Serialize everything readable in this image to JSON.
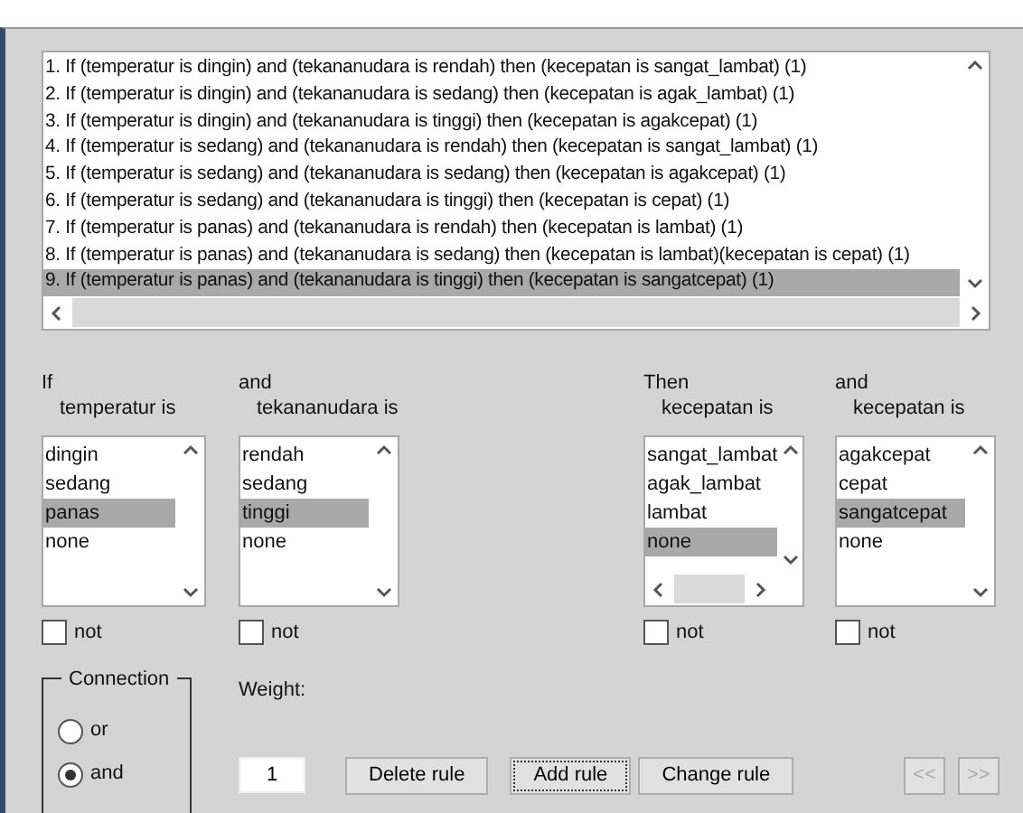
{
  "rules": [
    {
      "text": "1. If (temperatur is dingin) and (tekananudara is rendah) then (kecepatan is sangat_lambat) (1)",
      "selected": false
    },
    {
      "text": "2. If (temperatur is dingin) and (tekananudara is sedang) then (kecepatan is agak_lambat) (1)",
      "selected": false
    },
    {
      "text": "3. If (temperatur is dingin) and (tekananudara is tinggi) then (kecepatan is agakcepat) (1)",
      "selected": false
    },
    {
      "text": "4. If (temperatur is sedang) and (tekananudara is rendah) then (kecepatan is sangat_lambat) (1)",
      "selected": false
    },
    {
      "text": "5. If (temperatur is sedang) and (tekananudara is sedang) then (kecepatan is agakcepat) (1)",
      "selected": false
    },
    {
      "text": "6. If (temperatur is sedang) and (tekananudara is tinggi) then (kecepatan is cepat) (1)",
      "selected": false
    },
    {
      "text": "7. If (temperatur is panas) and (tekananudara is rendah) then (kecepatan is lambat) (1)",
      "selected": false
    },
    {
      "text": "8. If (temperatur is panas) and (tekananudara is sedang) then (kecepatan is lambat)(kecepatan is cepat) (1)",
      "selected": false
    },
    {
      "text": "9. If (temperatur is panas) and (tekananudara is tinggi) then (kecepatan is sangatcepat) (1)",
      "selected": true
    }
  ],
  "variables": [
    {
      "header": "If",
      "label": "temperatur is",
      "kind": "list",
      "items": [
        {
          "text": "dingin",
          "selected": false
        },
        {
          "text": "sedang",
          "selected": false
        },
        {
          "text": "panas",
          "selected": true
        },
        {
          "text": "none",
          "selected": false
        }
      ],
      "not_label": "not",
      "not_checked": false
    },
    {
      "header": "and",
      "label": "tekananudara is",
      "kind": "list",
      "items": [
        {
          "text": "rendah",
          "selected": false
        },
        {
          "text": "sedang",
          "selected": false
        },
        {
          "text": "tinggi",
          "selected": true
        },
        {
          "text": "none",
          "selected": false
        }
      ],
      "not_label": "not",
      "not_checked": false
    },
    {
      "header": "Then",
      "label": "kecepatan is",
      "kind": "list-hscroll",
      "items": [
        {
          "text": "sangat_lambat",
          "selected": false
        },
        {
          "text": "agak_lambat",
          "selected": false
        },
        {
          "text": "lambat",
          "selected": false
        },
        {
          "text": "none",
          "selected": true
        }
      ],
      "not_label": "not",
      "not_checked": false
    },
    {
      "header": "and",
      "label": "kecepatan is",
      "kind": "list",
      "items": [
        {
          "text": "agakcepat",
          "selected": false
        },
        {
          "text": "cepat",
          "selected": false
        },
        {
          "text": "sangatcepat",
          "selected": true
        },
        {
          "text": "none",
          "selected": false
        }
      ],
      "not_label": "not",
      "not_checked": false
    }
  ],
  "connection": {
    "title": "Connection",
    "options": [
      {
        "label": "or",
        "selected": false
      },
      {
        "label": "and",
        "selected": true
      }
    ]
  },
  "weight": {
    "label": "Weight:",
    "value": "1"
  },
  "buttons": [
    {
      "label": "Delete rule",
      "disabled": false,
      "focused": false
    },
    {
      "label": "Add rule",
      "disabled": false,
      "focused": true
    },
    {
      "label": "Change rule",
      "disabled": false,
      "focused": false
    }
  ],
  "nav_buttons": [
    {
      "label": "<<",
      "disabled": true
    },
    {
      "label": ">>",
      "disabled": true
    }
  ]
}
